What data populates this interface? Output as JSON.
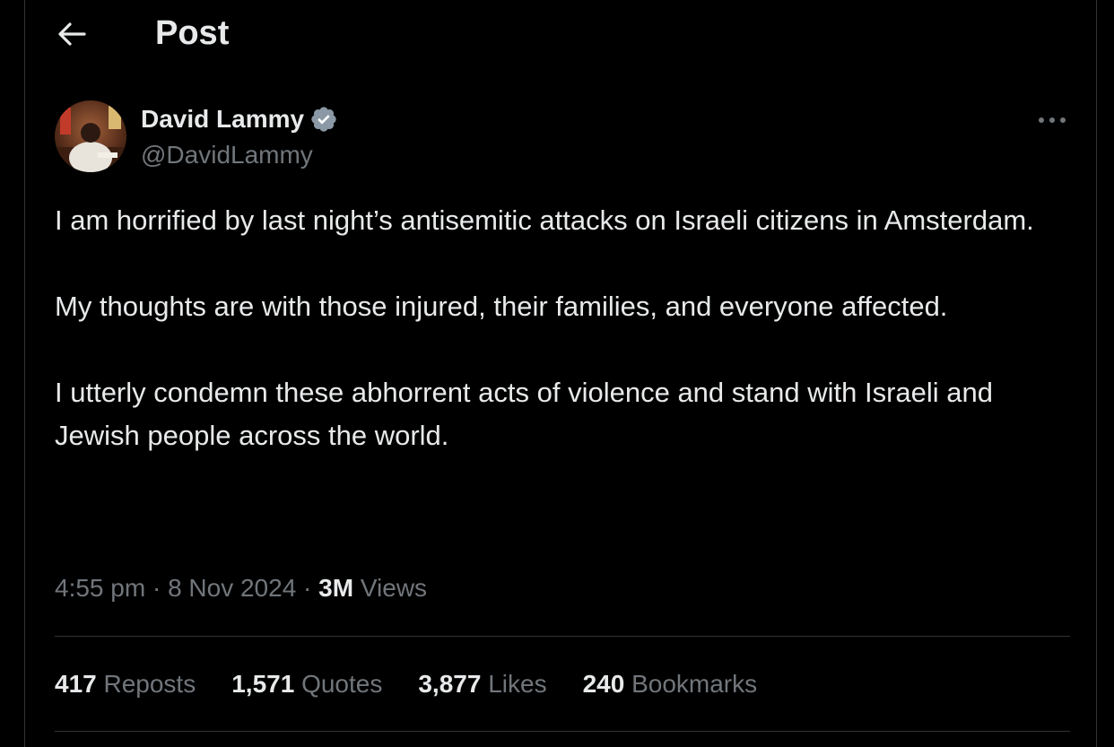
{
  "header": {
    "title": "Post",
    "back_icon": "arrow-left-icon"
  },
  "author": {
    "display_name": "David Lammy",
    "handle": "@DavidLammy",
    "verified": true,
    "verified_color": "#8b98a5"
  },
  "post": {
    "paragraphs": [
      "I am horrified by last night’s antisemitic attacks on Israeli citizens in Amsterdam.",
      "My thoughts are with those injured, their families, and everyone affected.",
      "I utterly condemn these abhorrent acts of violence and stand with Israeli and Jewish people across the world."
    ]
  },
  "meta": {
    "time": "4:55 pm",
    "separator": " · ",
    "date": "8 Nov 2024",
    "views_count": "3M",
    "views_label": " Views"
  },
  "stats": [
    {
      "count": "417",
      "label": " Reposts"
    },
    {
      "count": "1,571",
      "label": " Quotes"
    },
    {
      "count": "3,877",
      "label": " Likes"
    },
    {
      "count": "240",
      "label": " Bookmarks"
    }
  ],
  "colors": {
    "background": "#000000",
    "primary_text": "#e7e9ea",
    "secondary_text": "#71767b",
    "border": "#2f3336"
  }
}
